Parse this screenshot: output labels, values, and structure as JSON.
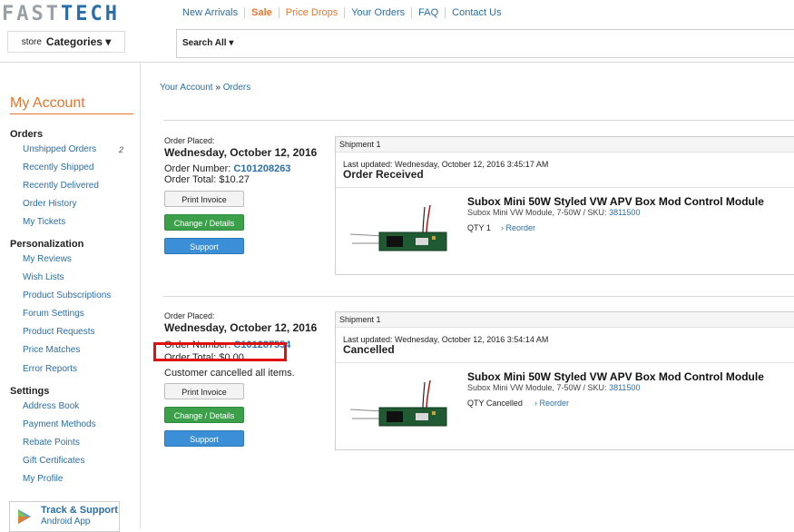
{
  "logo": {
    "part1": "FAST",
    "part2": "TECH"
  },
  "topnav": [
    "New Arrivals",
    "Sale",
    "Price Drops",
    "Your Orders",
    "FAQ",
    "Contact Us"
  ],
  "store_categories": {
    "prefix": "store",
    "label": "Categories ▾"
  },
  "search": {
    "scope": "Search All ▾",
    "placeholder": ""
  },
  "sidebar": {
    "title": "My Account",
    "orders_header": "Orders",
    "orders": [
      "Unshipped Orders",
      "Recently Shipped",
      "Recently Delivered",
      "Order History",
      "My Tickets"
    ],
    "unshipped_count": "2",
    "personalization_header": "Personalization",
    "personalization": [
      "My Reviews",
      "Wish Lists",
      "Product Subscriptions",
      "Forum Settings",
      "Product Requests",
      "Price Matches",
      "Error Reports"
    ],
    "settings_header": "Settings",
    "settings": [
      "Address Book",
      "Payment Methods",
      "Rebate Points",
      "Gift Certificates",
      "My Profile"
    ],
    "app": {
      "line1": "Track & Support",
      "line2": "Android App"
    }
  },
  "breadcrumb": {
    "root": "Your Account",
    "sep": "»",
    "current": "Orders"
  },
  "orders": [
    {
      "placed_label": "Order Placed:",
      "date": "Wednesday, October 12, 2016",
      "number_label": "Order Number:",
      "number": "C101208263",
      "total": "Order Total: $10.27",
      "note": "",
      "buttons": {
        "print": "Print Invoice",
        "change": "Change / Details",
        "support": "Support"
      },
      "shipment": {
        "header": "Shipment 1",
        "updated": "Last updated: Wednesday, October 12, 2016 3:45:17 AM",
        "status": "Order Received",
        "product_title": "Subox Mini 50W Styled VW APV Box Mod Control Module",
        "product_sub": "Subox Mini VW Module, 7-50W / SKU:",
        "sku": "3811500",
        "qty": "QTY 1",
        "reorder": "› Reorder"
      }
    },
    {
      "placed_label": "Order Placed:",
      "date": "Wednesday, October 12, 2016",
      "number_label": "Order Number:",
      "number": "C101287554",
      "total": "Order Total: $0.00",
      "note": "Customer cancelled all items.",
      "buttons": {
        "print": "Print Invoice",
        "change": "Change / Details",
        "support": "Support"
      },
      "shipment": {
        "header": "Shipment 1",
        "updated": "Last updated: Wednesday, October 12, 2016 3:54:14 AM",
        "status": "Cancelled",
        "product_title": "Subox Mini 50W Styled VW APV Box Mod Control Module",
        "product_sub": "Subox Mini VW Module, 7-50W / SKU:",
        "sku": "3811500",
        "qty": "QTY Cancelled",
        "reorder": "› Reorder"
      }
    }
  ],
  "colors": {
    "accent_orange": "#e8742c",
    "link_blue": "#2a6ea8",
    "green_button": "#3ca04b",
    "blue_button": "#3b8fd6",
    "highlight_red": "#e01010"
  }
}
